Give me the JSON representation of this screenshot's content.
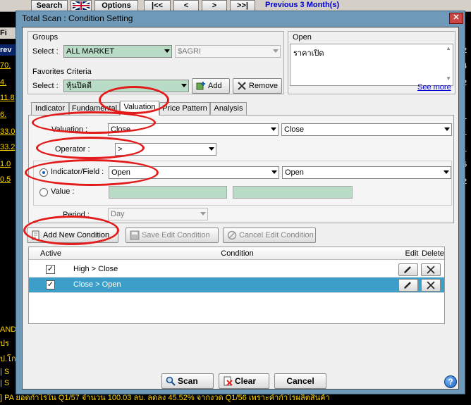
{
  "background": {
    "toolbar": {
      "search": "Search",
      "options": "Options",
      "nav_first": "|<<",
      "nav_prev": "<",
      "nav_next": ">",
      "nav_last": ">>|",
      "period_link": "Previous 3 Month(s)"
    },
    "left_labels": [
      "Fi",
      "rev",
      "70.",
      "4.",
      "11.8",
      "6.",
      "33.0",
      "33.2",
      "1.0",
      "0.5"
    ],
    "right_labels": [
      "2",
      "4",
      "2",
      "1",
      "1",
      "1",
      "5",
      "2"
    ],
    "bottom_left": [
      "AND",
      "ปร",
      "ป.โก",
      "| S",
      "| S"
    ],
    "ticker": "] PA ยอดกำไรใน Q1/57 จำนวน 100.03 ลบ. ลดลง 45.52% จากงวด Q1/56 เพราะคำกำไรผลิตสินค้า"
  },
  "dialog": {
    "title": "Total Scan : Condition Setting",
    "groups": {
      "title": "Groups",
      "select_label": "Select :",
      "group_value": "ALL MARKET",
      "subgroup_value": "$AGRI"
    },
    "open_panel": {
      "title": "Open",
      "text": "ราคาเปิด",
      "see_more": "See more"
    },
    "favorites": {
      "title": "Favorites Criteria",
      "select_label": "Select :",
      "value": "หุ้นปิดดี",
      "add": "Add",
      "remove": "Remove"
    },
    "tabs": [
      "Indicator",
      "Fundamental",
      "Valuation",
      "Price Pattern",
      "Analysis"
    ],
    "valuation": {
      "valuation_label": "Valuation :",
      "valuation_value": "Close",
      "valuation_value2": "Close",
      "operator_label": "Operator :",
      "operator_value": ">",
      "indicator_label": "Indicator/Field :",
      "indicator_value": "Open",
      "indicator_value2": "Open",
      "value_label": "Value :",
      "period_label": "Period :",
      "period_value": "Day"
    },
    "actions": {
      "add_new": "Add New Condition",
      "save_edit": "Save Edit Condition",
      "cancel_edit": "Cancel Edit Condition"
    },
    "grid": {
      "headers": [
        "Active",
        "Condition",
        "Edit",
        "Delete"
      ],
      "rows": [
        {
          "active": "✓",
          "condition": "High > Close"
        },
        {
          "active": "✓",
          "condition": "Close > Open"
        }
      ]
    },
    "footer": {
      "scan": "Scan",
      "clear": "Clear",
      "cancel": "Cancel"
    }
  }
}
